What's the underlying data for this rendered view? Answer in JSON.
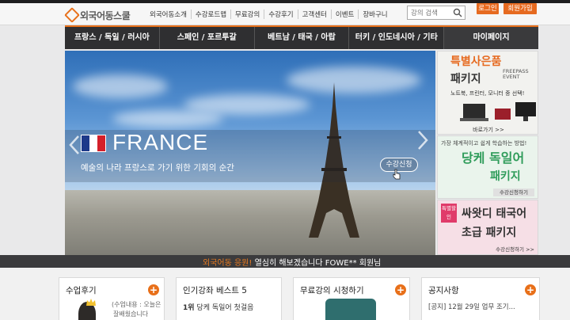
{
  "site": {
    "logo_text": "외국어동스쿨"
  },
  "topnav": {
    "items": [
      "외국어동소개",
      "수강로드맵",
      "무료강의",
      "수강후기",
      "고객센터",
      "이벤트",
      "장바구니"
    ]
  },
  "search": {
    "placeholder": "강의 검색"
  },
  "auth": {
    "login_label": "로그인",
    "join_label": "회원가입"
  },
  "gnb": {
    "items": [
      "프랑스 / 독일 / 러시아",
      "스페인 / 포르투갈",
      "베트남 / 태국 / 아랍",
      "터키 / 인도네시아 / 기타",
      "마이페이지"
    ]
  },
  "hero": {
    "country": "FRANCE",
    "subtitle": "예술의 나라 프랑스로 가기 위한 기회의 순간",
    "button_label": "수강신청",
    "flag_colors": [
      "#1e3a8a",
      "#ffffff",
      "#d4202a"
    ]
  },
  "side": {
    "banner1": {
      "title_line1": "특별사은품",
      "title_line2": "패키지",
      "tag_line1": "FREEPASS",
      "tag_line2": "EVENT",
      "desc": "노트북, 프린터, 모니터 중 선택!",
      "more": "바로가기 >>"
    },
    "banner2": {
      "desc": "가장 체계적이고 쉽게 학습하는 방법!",
      "title_line1": "당케 독일어",
      "title_line2": "패키지",
      "more": "수강신청하기"
    },
    "banner3": {
      "badge": "특별할인",
      "title_line1": "싸왓디 태국어",
      "title_line2": "초급 패키지",
      "more": "수강신청하기 >>"
    }
  },
  "ticker": {
    "prefix": "외국어동 응원!",
    "message": "열심히 해보겠습니다 FOWE** 회원님"
  },
  "bottom": {
    "box1": {
      "title": "수업후기",
      "line": "(수업내용 : 오늘은",
      "line2": "잘배웠습니다"
    },
    "box2": {
      "title": "인기강좌 베스트 5",
      "rank": "1위",
      "line": "당케 독일어 첫걸음"
    },
    "box3": {
      "title": "무료강의 시청하기"
    },
    "box4": {
      "title": "공지사항",
      "line": "[공지] 12월 29일 업무 조기..."
    }
  },
  "colors": {
    "accent": "#e8701a",
    "nav_bg": "#2f2f31"
  }
}
